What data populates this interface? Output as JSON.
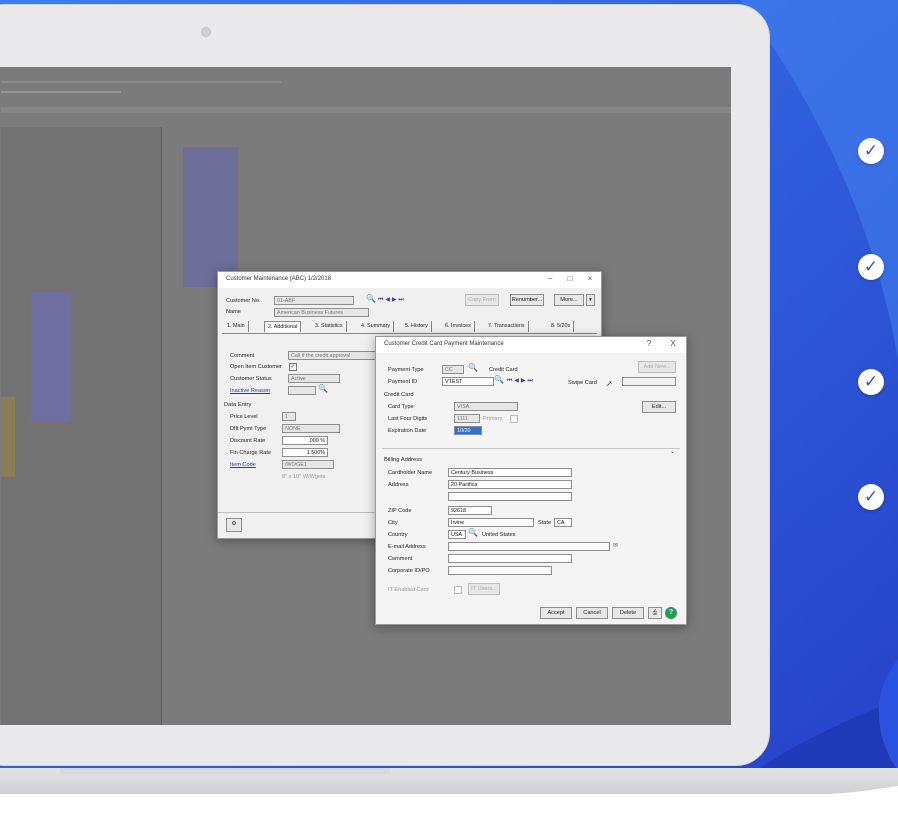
{
  "colors": {
    "blue_gradient_start": "#3a7ef0",
    "blue_gradient_end": "#2540c8",
    "laptop_frame": "#e9e9eb",
    "screen_bg": "#7b7b7b",
    "check_color": "#2b54d8"
  },
  "checklist": {
    "icon": "check-icon",
    "count": 4
  },
  "customer_maintenance": {
    "title": "Customer Maintenance (ABC) 1/2/2018",
    "customer_no_label": "Customer No.",
    "customer_no_value": "01-ABF",
    "name_label": "Name",
    "name_value": "American Business Futures",
    "copy_from": "Copy From",
    "renumber": "Renumber...",
    "more": "More...",
    "tabs": [
      "1. Main",
      "2. Additional",
      "3. Statistics",
      "4. Summary",
      "5. History",
      "6. Invoices",
      "7. Transactions",
      "8. 5/20s"
    ],
    "comment_label": "Comment",
    "comment_value": "Call if the credit approval",
    "open_item_label": "Open Item Customer",
    "customer_status_label": "Customer Status",
    "customer_status_value": "Active",
    "inactive_reason_label": "Inactive Reason",
    "data_entry_label": "Data Entry",
    "price_level_label": "Price Level",
    "price_level_value": "1",
    "dflt_pymt_label": "Dflt Pymt Type",
    "dflt_pymt_value": "NONE",
    "discount_rate_label": "Discount Rate",
    "discount_rate_value": ".000 %",
    "fin_charge_label": "Fin Charge Rate",
    "fin_charge_value": "1.500%",
    "item_code_label": "Item Code",
    "item_code_value": "/W0/GE1",
    "item_desc": "8\" x 10\" W/Wgets"
  },
  "cc_payment": {
    "title": "Customer Credit Card Payment Maintenance",
    "help": "?",
    "close": "X",
    "payment_type_label": "Payment Type",
    "payment_type_value": "CC",
    "payment_type_desc": "Credit Card",
    "payment_id_label": "Payment ID",
    "payment_id_value": "VTEST",
    "swipe_card": "Swipe Card",
    "add_new": "Add New...",
    "credit_card_section": "Credit Card",
    "card_type_label": "Card Type",
    "card_type_value": "VISA",
    "last_four_label": "Last Four Digits",
    "last_four_value": "1111",
    "primary_label": "Primary",
    "expiration_label": "Expiration Date",
    "expiration_value": "10/20",
    "edit": "Edit...",
    "billing_section": "Billing Address",
    "cardholder_label": "Cardholder Name",
    "cardholder_value": "Century Business",
    "address_label": "Address",
    "address_value": "20 Pacifica",
    "zip_label": "ZIP Code",
    "zip_value": "92618",
    "city_label": "City",
    "city_value": "Irvine",
    "state_label": "State",
    "state_value": "CA",
    "country_label": "Country",
    "country_value": "USA",
    "country_desc": "United States",
    "email_label": "E-mail Address",
    "comment_label": "Comment",
    "corporate_id_label": "Corporate ID/PO",
    "it_enabled_label": "IT Enabled Card",
    "it_users": "IT Users...",
    "accept": "Accept",
    "cancel": "Cancel",
    "delete": "Delete"
  }
}
